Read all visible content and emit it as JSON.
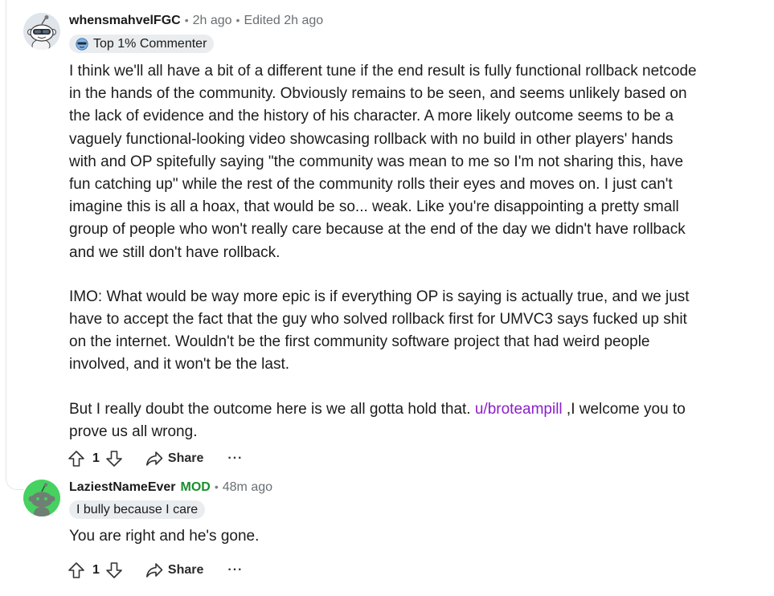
{
  "comments": [
    {
      "username": "whensmahvelFGC",
      "time": "2h ago",
      "edited": "Edited 2h ago",
      "flair": {
        "emoji": "sunglasses",
        "text": "Top 1% Commenter"
      },
      "paragraphs": [
        "I think we'll all have a bit of a different tune if the end result is fully functional rollback netcode in the hands of the community. Obviously remains to be seen, and seems unlikely based on the lack of evidence and the history of his character. A more likely outcome seems to be a vaguely functional-looking video showcasing rollback with no build in other players' hands with and OP spitefully saying \"the community was mean to me so I'm not sharing this, have fun catching up\" while the rest of the community rolls their eyes and moves on. I just can't imagine this is all a hoax, that would be so... weak. Like you're disappointing a pretty small group of people who won't really care because at the end of the day we didn't have rollback and we still don't have rollback.",
        "IMO: What would be way more epic is if everything OP is saying is actually true, and we just have to accept the fact that the guy who solved rollback first for UMVC3 says fucked up shit on the internet. Wouldn't be the first community software project that had weird people involved, and it won't be the last."
      ],
      "last_paragraph": {
        "before": "But I really doubt the outcome here is we all gotta hold that. ",
        "link": "u/broteampill",
        "after": " ,I welcome you to prove us all wrong."
      },
      "votes": "1",
      "share_label": "Share",
      "more_label": "···"
    },
    {
      "username": "LaziestNameEver",
      "mod_tag": "MOD",
      "time": "48m ago",
      "flair": {
        "text": "I bully because I care"
      },
      "paragraphs": [
        "You are right and he's gone."
      ],
      "votes": "1",
      "share_label": "Share",
      "more_label": "···"
    }
  ],
  "separator": "•",
  "colors": {
    "link": "#8b1fc9",
    "mod": "#1a8e2d",
    "flair_bg": "#eaedef",
    "thread_line": "#e3e6e8",
    "avatar2_bg": "#46d160"
  },
  "icons": {
    "upvote": "upvote-arrow",
    "downvote": "downvote-arrow",
    "share": "share-arrow",
    "more": "ellipsis"
  }
}
